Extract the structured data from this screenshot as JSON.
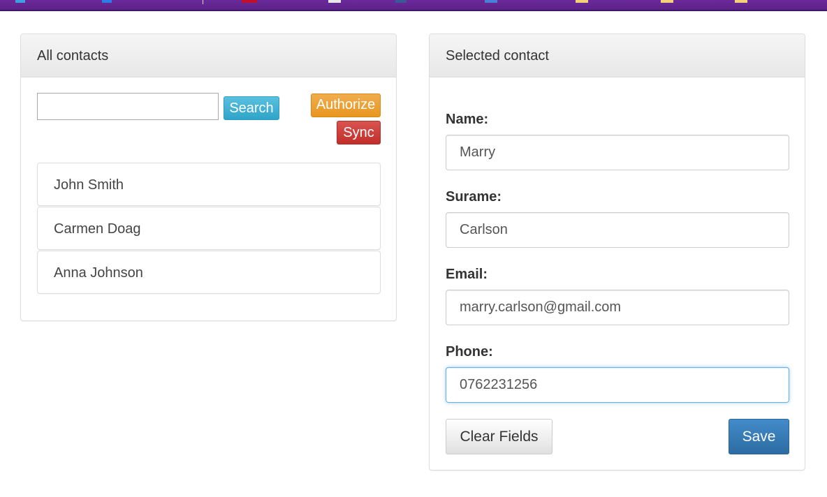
{
  "contacts_panel": {
    "title": "All contacts",
    "search": {
      "value": "",
      "placeholder": ""
    },
    "search_label": "Search",
    "authorize_label": "Authorize",
    "sync_label": "Sync",
    "contacts": [
      "John Smith",
      "Carmen Doag",
      "Anna Johnson"
    ]
  },
  "selected_panel": {
    "title": "Selected contact",
    "fields": [
      {
        "label": "Name:",
        "value": "Marry"
      },
      {
        "label": "Surame:",
        "value": "Carlson"
      },
      {
        "label": "Email:",
        "value": "marry.carlson@gmail.com"
      },
      {
        "label": "Phone:",
        "value": "0762231256"
      }
    ],
    "clear_label": "Clear Fields",
    "save_label": "Save"
  },
  "colors": {
    "browser_bar": "#5d2289",
    "search_button": "#5bc0de",
    "authorize_button": "#f0ad4e",
    "sync_button": "#d9534f",
    "save_button": "#428bca",
    "focus_ring": "#66afe9"
  }
}
